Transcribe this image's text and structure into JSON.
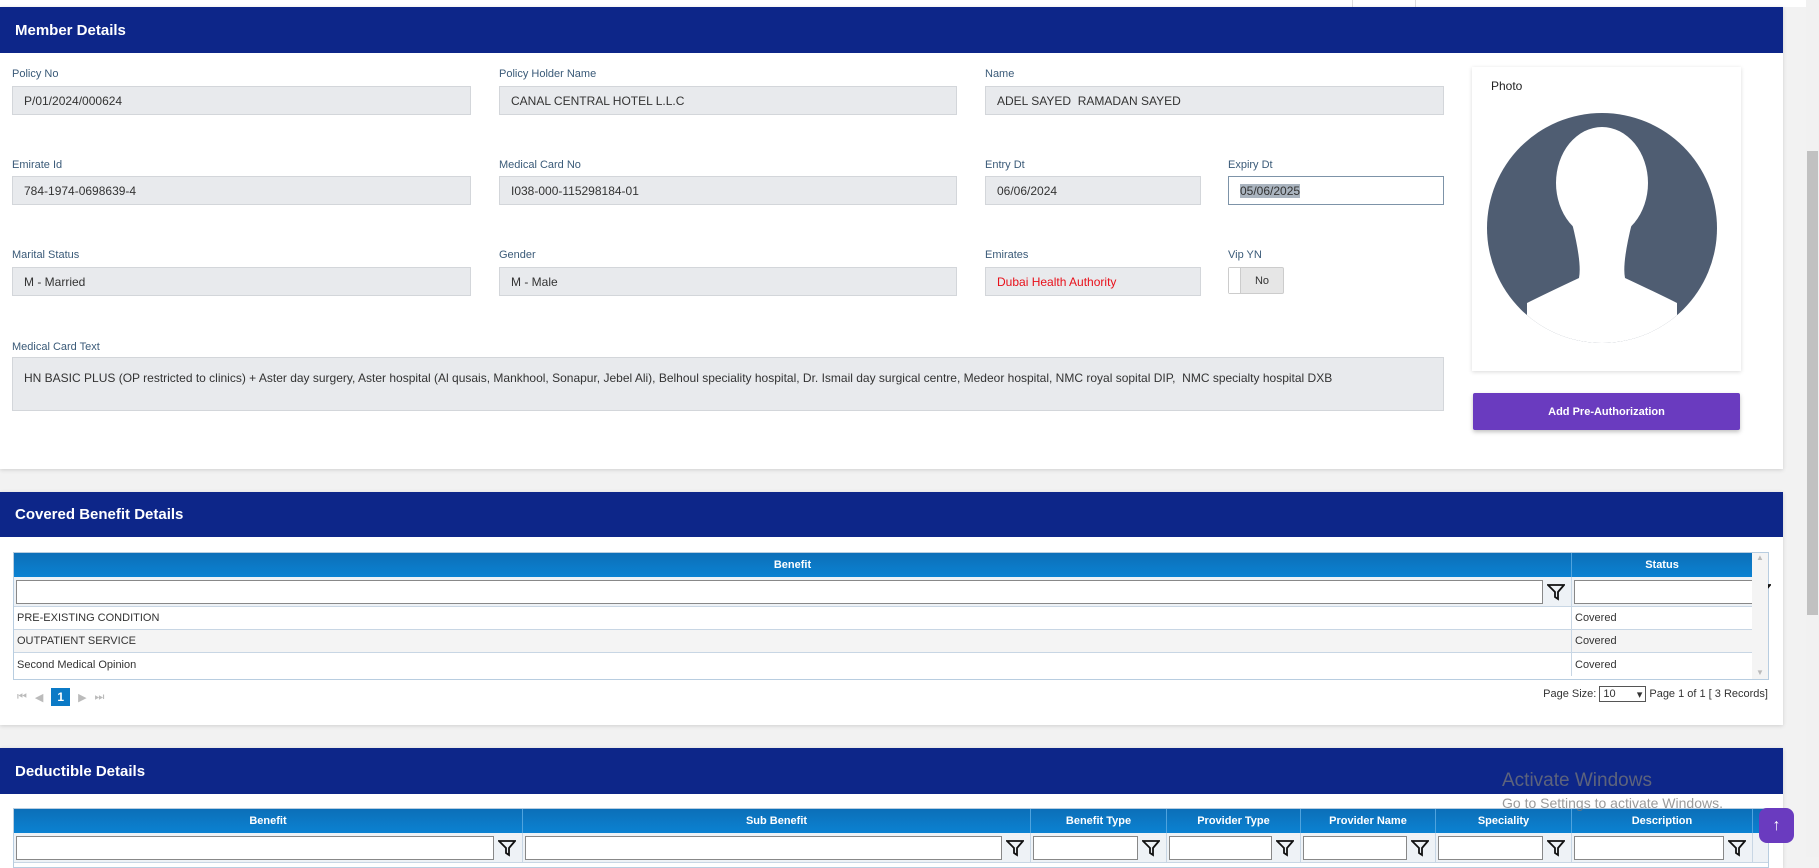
{
  "member": {
    "title": "Member Details",
    "policy_no": {
      "label": "Policy No",
      "value": "P/01/2024/000624"
    },
    "policy_holder": {
      "label": "Policy Holder Name",
      "value": "CANAL CENTRAL HOTEL L.L.C"
    },
    "name": {
      "label": "Name",
      "value": "ADEL SAYED  RAMADAN SAYED"
    },
    "emirate_id": {
      "label": "Emirate Id",
      "value": "784-1974-0698639-4"
    },
    "medical_card_no": {
      "label": "Medical Card No",
      "value": "I038-000-115298184-01"
    },
    "entry_dt": {
      "label": "Entry Dt",
      "value": "06/06/2024"
    },
    "expiry_dt": {
      "label": "Expiry Dt",
      "value": "05/06/2025"
    },
    "marital_status": {
      "label": "Marital Status",
      "value": "M - Married"
    },
    "gender": {
      "label": "Gender",
      "value": "M - Male"
    },
    "emirates": {
      "label": "Emirates",
      "value": "Dubai Health Authority"
    },
    "vip": {
      "label": "Vip YN",
      "value": "No"
    },
    "medical_card_text": {
      "label": "Medical Card Text",
      "value": "HN BASIC PLUS (OP restricted to clinics) + Aster day surgery, Aster hospital (Al qusais, Mankhool, Sonapur, Jebel Ali), Belhoul speciality hospital, Dr. Ismail day surgical centre, Medeor hospital, NMC royal sopital DIP,  NMC specialty hospital DXB"
    },
    "photo_label": "Photo",
    "add_preauth": "Add Pre-Authorization"
  },
  "covered": {
    "title": "Covered Benefit Details",
    "columns": [
      "Benefit",
      "Status"
    ],
    "rows": [
      [
        "PRE-EXISTING CONDITION",
        "Covered"
      ],
      [
        "OUTPATIENT SERVICE",
        "Covered"
      ],
      [
        "Second Medical Opinion",
        "Covered"
      ]
    ],
    "pager": {
      "current": "1",
      "page_size_label": "Page Size:",
      "page_size": "10",
      "info": "Page 1 of 1 [ 3 Records]"
    }
  },
  "deductible": {
    "title": "Deductible Details",
    "columns": [
      "Benefit",
      "Sub Benefit",
      "Benefit Type",
      "Provider Type",
      "Provider Name",
      "Speciality",
      "Description"
    ]
  },
  "watermark": {
    "title": "Activate Windows",
    "sub": "Go to Settings to activate Windows."
  },
  "colors": {
    "header": "#0d2689",
    "grid_header": "#0b7ac6",
    "button": "#6a3bbf",
    "emirates_text": "#e8101a"
  }
}
